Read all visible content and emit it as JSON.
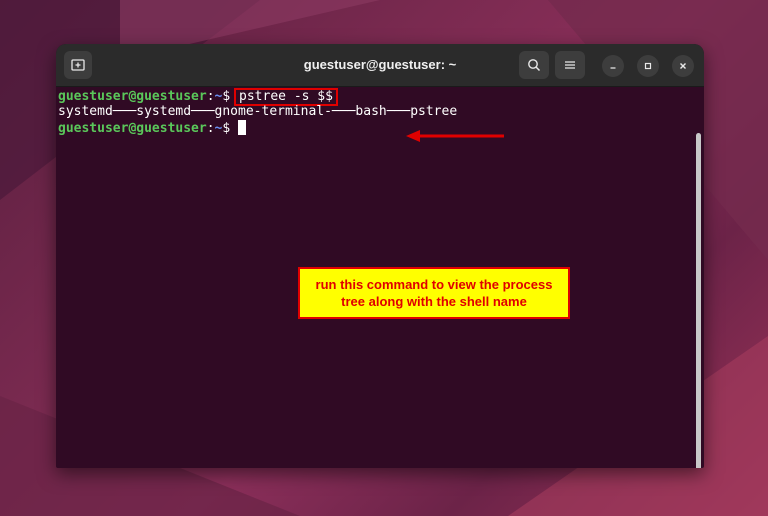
{
  "window": {
    "title": "guestuser@guestuser: ~"
  },
  "terminal": {
    "lines": [
      {
        "user": "guestuser@guestuser",
        "sep": ":",
        "path": "~",
        "prompt": "$ ",
        "command": "pstree -s $$"
      },
      {
        "output": "systemd───systemd───gnome-terminal-───bash───pstree"
      },
      {
        "user": "guestuser@guestuser",
        "sep": ":",
        "path": "~",
        "prompt": "$ "
      }
    ]
  },
  "annotation": {
    "text": "run this command to view the process tree along with the shell name"
  },
  "icons": {
    "new_tab": "new-tab-icon",
    "search": "search-icon",
    "menu": "hamburger-menu-icon",
    "minimize": "minimize-icon",
    "maximize": "maximize-icon",
    "close": "close-icon"
  },
  "colors": {
    "terminal_bg": "#300a24",
    "user_green": "#5ac75a",
    "path_blue": "#6a8ef0",
    "annotation_bg": "#ffff00",
    "annotation_red": "#e00000"
  }
}
